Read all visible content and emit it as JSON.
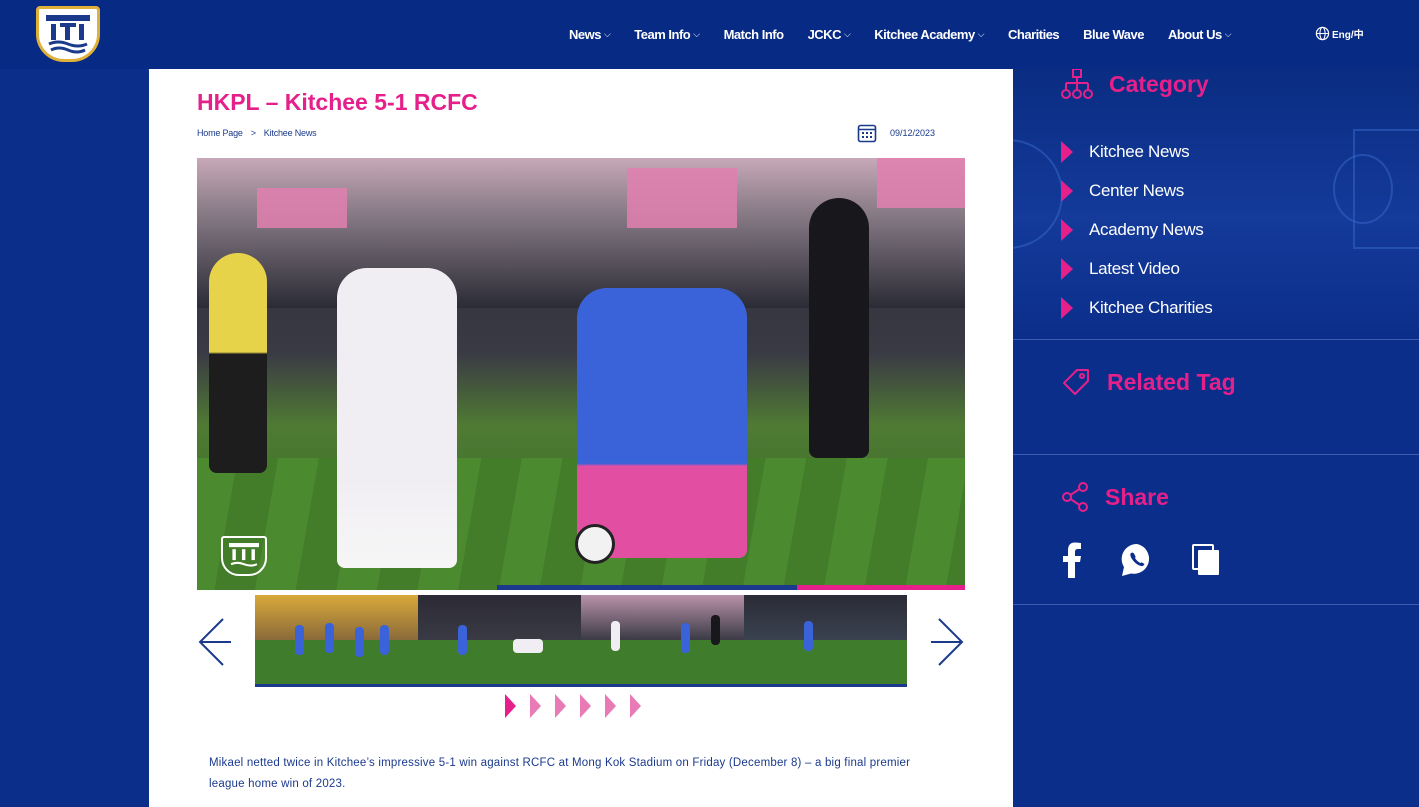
{
  "nav": {
    "items": [
      {
        "label": "News",
        "dropdown": true
      },
      {
        "label": "Team Info",
        "dropdown": true
      },
      {
        "label": "Match Info",
        "dropdown": false
      },
      {
        "label": "JCKC",
        "dropdown": true
      },
      {
        "label": "Kitchee Academy",
        "dropdown": true
      },
      {
        "label": "Charities",
        "dropdown": false
      },
      {
        "label": "Blue Wave",
        "dropdown": false
      },
      {
        "label": "About Us",
        "dropdown": true
      }
    ],
    "language": "Eng/中"
  },
  "article": {
    "title": "HKPL – Kitchee 5-1 RCFC",
    "breadcrumb": {
      "home": "Home Page",
      "separator": ">",
      "section": "Kitchee News"
    },
    "date": "09/12/2023",
    "body": "Mikael netted twice in Kitchee’s impressive 5-1 win against RCFC at Mong Kok Stadium on Friday (December 8) – a big final premier league home win of 2023."
  },
  "gallery": {
    "thumbnail_count": 4,
    "page_dots": 6,
    "active_dot": 0
  },
  "sidebar": {
    "category_title": "Category",
    "categories": [
      "Kitchee News",
      "Center News",
      "Academy News",
      "Latest Video",
      "Kitchee Charities"
    ],
    "related_tag_title": "Related Tag",
    "share_title": "Share",
    "share_icons": [
      "facebook-icon",
      "whatsapp-icon",
      "copy-icon"
    ]
  },
  "colors": {
    "brand_blue": "#0b2e8a",
    "header_blue": "#072a85",
    "accent_pink": "#e6208b",
    "text_blue": "#1b3a8c"
  }
}
